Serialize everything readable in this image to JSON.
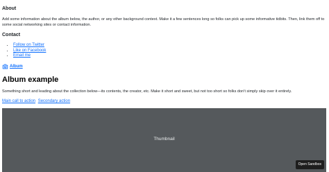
{
  "about": {
    "heading": "About",
    "text": "Add some information about the album below, the author, or any other background context. Make it a few sentences long so folks can pick up some informative tidbits. Then, link them off to some social networking sites or contact information."
  },
  "contact": {
    "heading": "Contact",
    "links": [
      {
        "label": "Follow on Twitter"
      },
      {
        "label": "Like on Facebook"
      },
      {
        "label": "Email me"
      }
    ]
  },
  "brand": {
    "label": "Album",
    "icon": "camera-icon"
  },
  "album": {
    "title": "Album example",
    "lead": "Something short and leading about the collection below—its contents, the creator, etc. Make it short and sweet, but not too short so folks don't simply skip over it entirely.",
    "primary_action": "Main call to action",
    "secondary_action": "Secondary action"
  },
  "thumbnail": {
    "label": "Thumbnail",
    "background": "#55595c"
  },
  "sandbox": {
    "label": "Open Sandbox"
  },
  "colors": {
    "link": "#0d6efd",
    "text": "#212529"
  }
}
